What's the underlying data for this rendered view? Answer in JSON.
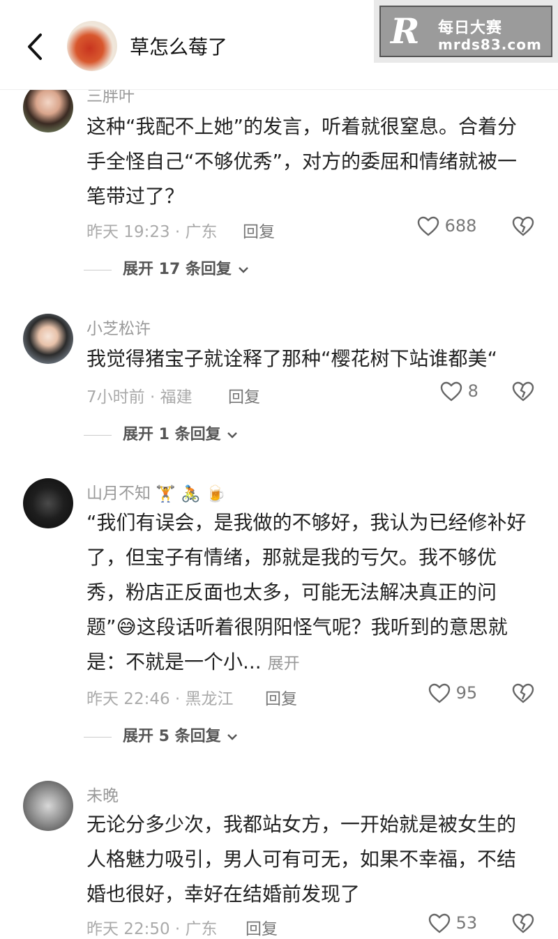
{
  "header": {
    "title": "草怎么莓了",
    "back_icon": "chevron-left-icon"
  },
  "watermark": {
    "logo": "R",
    "cn": "每日大赛",
    "url": "mrds83.com"
  },
  "comments": [
    {
      "name": "三胖叶",
      "text": "这种“我配不上她”的发言，听着就很窒息。合着分手全怪自己“不够优秀”，对方的委屈和情绪就被一笔带过了？",
      "time_location": "昨天 19:23 · 广东",
      "reply_label": "回复",
      "likes": "688",
      "expand": "展开 17 条回复"
    },
    {
      "name": "小芝松许",
      "text": "我觉得猪宝子就诠释了那种“樱花树下站谁都美“",
      "time_location": "7小时前 · 福建",
      "reply_label": "回复",
      "likes": "8",
      "expand": "展开 1 条回复"
    },
    {
      "name": "山月不知",
      "name_emojis": [
        "🏋️",
        "🚴",
        "🍺"
      ],
      "text_part1": "“我们有误会，是我做的不够好，我认为已经修补好了，但宝子有情绪，那就是我的亏欠。我不够优秀，粉店正反面也太多，可能无法解决真正的问题”",
      "text_emoji": "😅",
      "text_part2": "这段话听着很阴阳怪气呢？我听到的意思就是：不就是一个小...",
      "more_label": "展开",
      "time_location": "昨天 22:46 · 黑龙江",
      "reply_label": "回复",
      "likes": "95",
      "expand": "展开 5 条回复"
    },
    {
      "name": "未晚",
      "text": "无论分多少次，我都站女方，一开始就是被女生的人格魅力吸引，男人可有可无，如果不幸福，不结婚也很好，幸好在结婚前发现了",
      "time_location": "昨天 22:50 · 广东",
      "reply_label": "回复",
      "likes": "53"
    }
  ]
}
